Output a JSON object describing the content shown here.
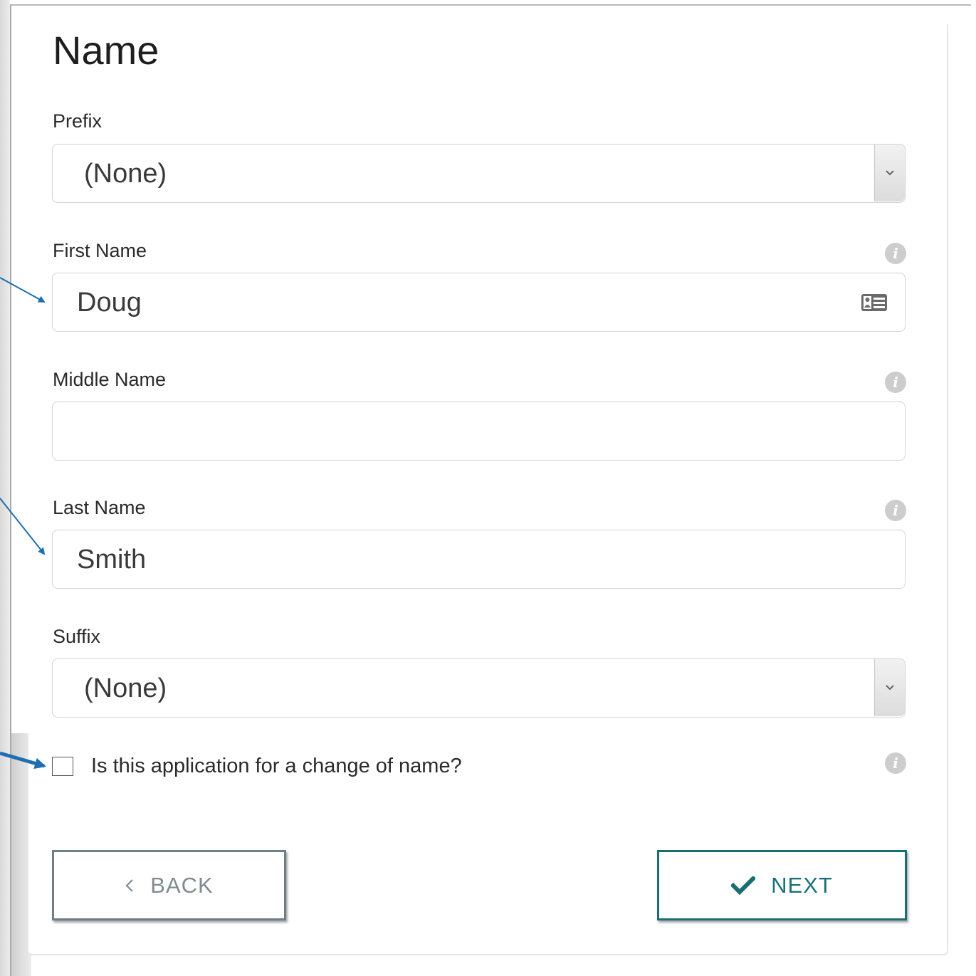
{
  "form": {
    "title": "Name",
    "prefix": {
      "label": "Prefix",
      "value": "(None)"
    },
    "first_name": {
      "label": "First Name",
      "value": "Doug"
    },
    "middle_name": {
      "label": "Middle Name",
      "value": ""
    },
    "last_name": {
      "label": "Last Name",
      "value": "Smith"
    },
    "suffix": {
      "label": "Suffix",
      "value": "(None)"
    },
    "change_of_name": {
      "label": "Is this application for a change of name?",
      "checked": false
    }
  },
  "buttons": {
    "back_label": "BACK",
    "next_label": "NEXT"
  },
  "icons": {
    "info": "info-icon",
    "contact_card": "contact-card-icon",
    "dropdown": "chevron-down-icon",
    "back": "chevron-left-icon",
    "next": "checkmark-icon"
  },
  "colors": {
    "accent": "#1b6d74",
    "back_border": "#6c7f87",
    "annotation_arrow": "#1f6fb0"
  }
}
